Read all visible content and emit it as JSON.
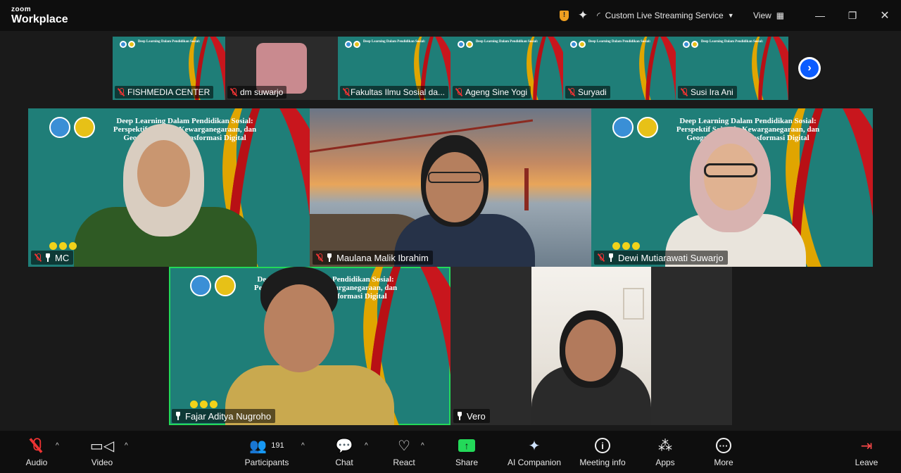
{
  "app": {
    "logo_line1": "zoom",
    "logo_line2": "Workplace"
  },
  "titlebar": {
    "streaming_label": "Custom Live Streaming Service",
    "view_label": "View"
  },
  "thumbnails": [
    {
      "name": "FISHMEDIA CENTER",
      "type": "slide"
    },
    {
      "name": "dm suwarjo",
      "type": "avatar"
    },
    {
      "name": "Fakultas Ilmu Sosial da...",
      "type": "slide"
    },
    {
      "name": "Ageng Sine Yogi",
      "type": "slide"
    },
    {
      "name": "Suryadi",
      "type": "slide"
    },
    {
      "name": "Susi Ira Ani",
      "type": "slide"
    }
  ],
  "slide": {
    "title_line1": "Deep Learning Dalam Pendidikan Sosial:",
    "title_line2": "Perspektif Sejarah, Kewarganegaraan, dan",
    "title_line3": "Geografi di Era Transformasi Digital"
  },
  "participants_grid": [
    {
      "name": "MC",
      "muted": true
    },
    {
      "name": "Maulana Malik Ibrahim",
      "muted": true
    },
    {
      "name": "Dewi Mutiarawati Suwarjo",
      "muted": true
    },
    {
      "name": "Fajar Aditya Nugroho",
      "muted": false,
      "active": true
    },
    {
      "name": "Vero",
      "muted": false
    }
  ],
  "toolbar": {
    "audio": "Audio",
    "video": "Video",
    "participants": "Participants",
    "participants_count": "191",
    "chat": "Chat",
    "react": "React",
    "share": "Share",
    "ai_companion": "AI Companion",
    "meeting_info": "Meeting info",
    "apps": "Apps",
    "more": "More",
    "leave": "Leave"
  },
  "colors": {
    "accent_blue": "#0b5cff",
    "share_green": "#23d959",
    "active_speaker": "#23d959",
    "muted_red": "#e33333",
    "slide_teal": "#1f7e78"
  }
}
